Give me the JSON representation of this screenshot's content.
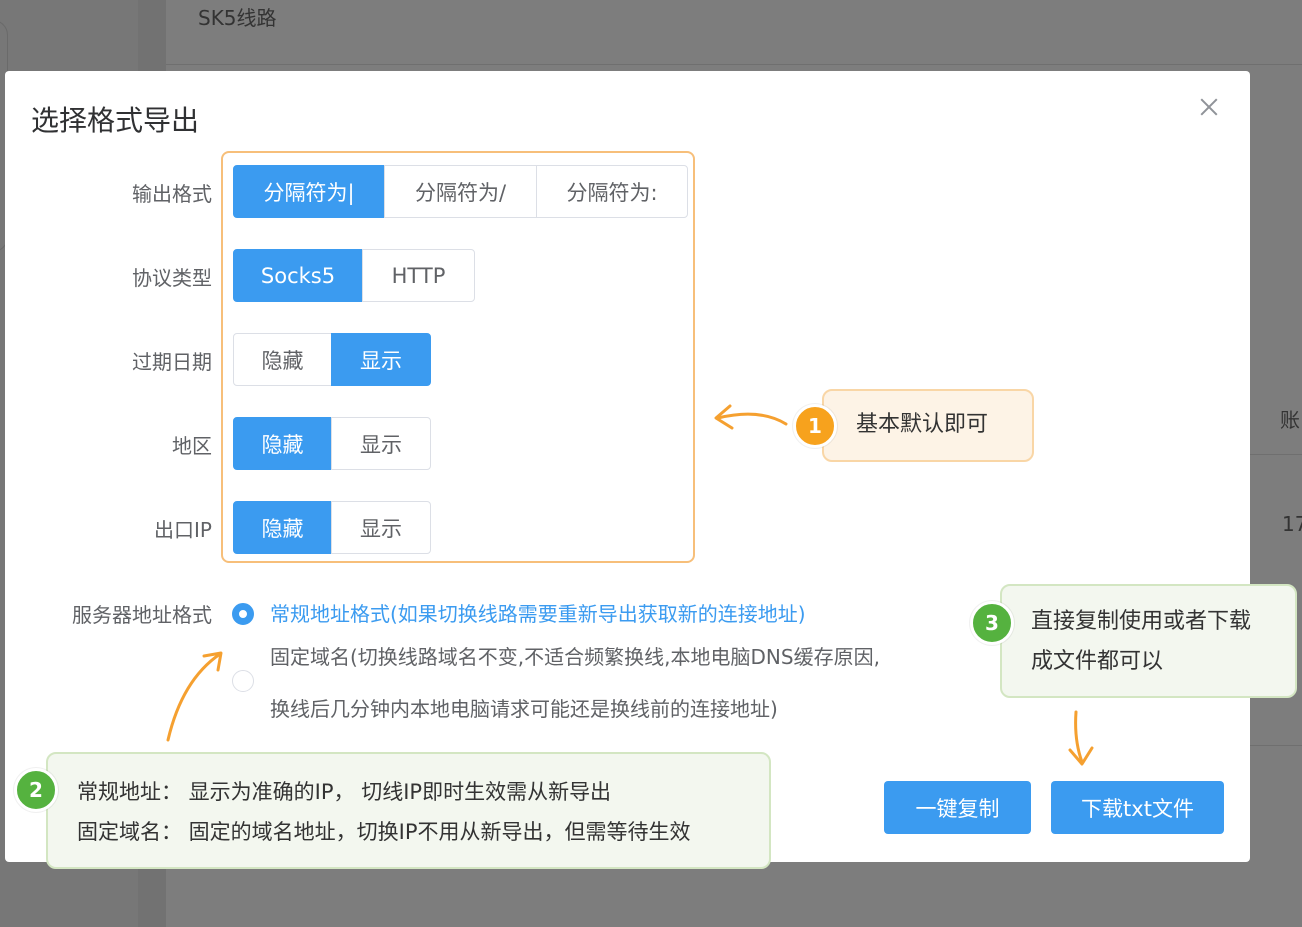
{
  "background": {
    "title": "SK5线路",
    "column_header": "账",
    "cell": "17"
  },
  "modal": {
    "title": "选择格式导出",
    "rows": [
      {
        "label": "输出格式",
        "options": [
          "分隔符为|",
          "分隔符为/",
          "分隔符为:"
        ],
        "selected": 0
      },
      {
        "label": "协议类型",
        "options": [
          "Socks5",
          "HTTP"
        ],
        "selected": 0
      },
      {
        "label": "过期日期",
        "options": [
          "隐藏",
          "显示"
        ],
        "selected": 1
      },
      {
        "label": "地区",
        "options": [
          "隐藏",
          "显示"
        ],
        "selected": 0
      },
      {
        "label": "出口IP",
        "options": [
          "隐藏",
          "显示"
        ],
        "selected": 0
      }
    ],
    "server_format": {
      "label": "服务器地址格式",
      "options": [
        {
          "text": "常规地址格式(如果切换线路需要重新导出获取新的连接地址)",
          "checked": true
        },
        {
          "line1": "固定域名(切换线路域名不变,不适合频繁换线,本地电脑DNS缓存原因,",
          "line2": "换线后几分钟内本地电脑请求可能还是换线前的连接地址)",
          "checked": false
        }
      ]
    },
    "copy_button": "一键复制",
    "download_button": "下载txt文件"
  },
  "callouts": {
    "one": {
      "badge": "1",
      "text": "基本默认即可"
    },
    "two": {
      "badge": "2",
      "line1": "常规地址：  显示为准确的IP，  切线IP即时生效需从新导出",
      "line2": "固定域名：  固定的域名地址，切换IP不用从新导出，但需等待生效"
    },
    "three": {
      "badge": "3",
      "line1": "直接复制使用或者下载",
      "line2": "成文件都可以"
    }
  },
  "colors": {
    "primary": "#3b9bf0",
    "highlight": "#f7bf7a",
    "orange": "#f7a21d",
    "green": "#55b23f"
  }
}
